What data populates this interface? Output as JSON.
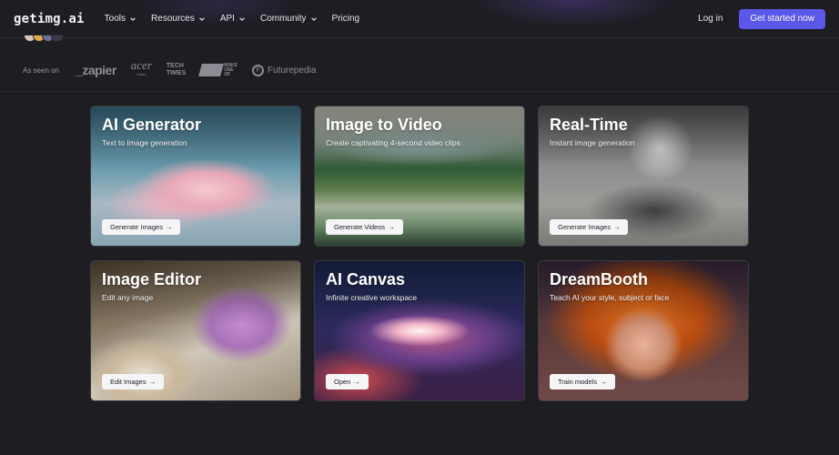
{
  "header": {
    "logo": "getimg.ai",
    "nav": [
      {
        "label": "Tools",
        "has_dropdown": true
      },
      {
        "label": "Resources",
        "has_dropdown": true
      },
      {
        "label": "API",
        "has_dropdown": true
      },
      {
        "label": "Community",
        "has_dropdown": true
      },
      {
        "label": "Pricing",
        "has_dropdown": false
      }
    ],
    "login": "Log in",
    "cta": "Get started now",
    "accent": "#5b57e8"
  },
  "seen_on": {
    "label": "As seen on",
    "brands": {
      "zapier": "_zapier",
      "acer": "acer",
      "acer_sub": "corner",
      "techtimes_1": "TECH",
      "techtimes_2": "TIMES",
      "muo_1": "MAKE",
      "muo_2": "USE",
      "muo_3": "OF",
      "futurepedia": "Futurepedia"
    }
  },
  "cards": [
    {
      "title": "AI Generator",
      "subtitle": "Text to Image generation",
      "button": "Generate Images"
    },
    {
      "title": "Image to Video",
      "subtitle": "Create captivating 4-second video clips",
      "button": "Generate Videos"
    },
    {
      "title": "Real-Time",
      "subtitle": "Instant image generation",
      "button": "Generate Images"
    },
    {
      "title": "Image Editor",
      "subtitle": "Edit any image",
      "button": "Edit Images"
    },
    {
      "title": "AI Canvas",
      "subtitle": "Infinite creative workspace",
      "button": "Open"
    },
    {
      "title": "DreamBooth",
      "subtitle": "Teach AI your style, subject or face",
      "button": "Train models"
    }
  ]
}
